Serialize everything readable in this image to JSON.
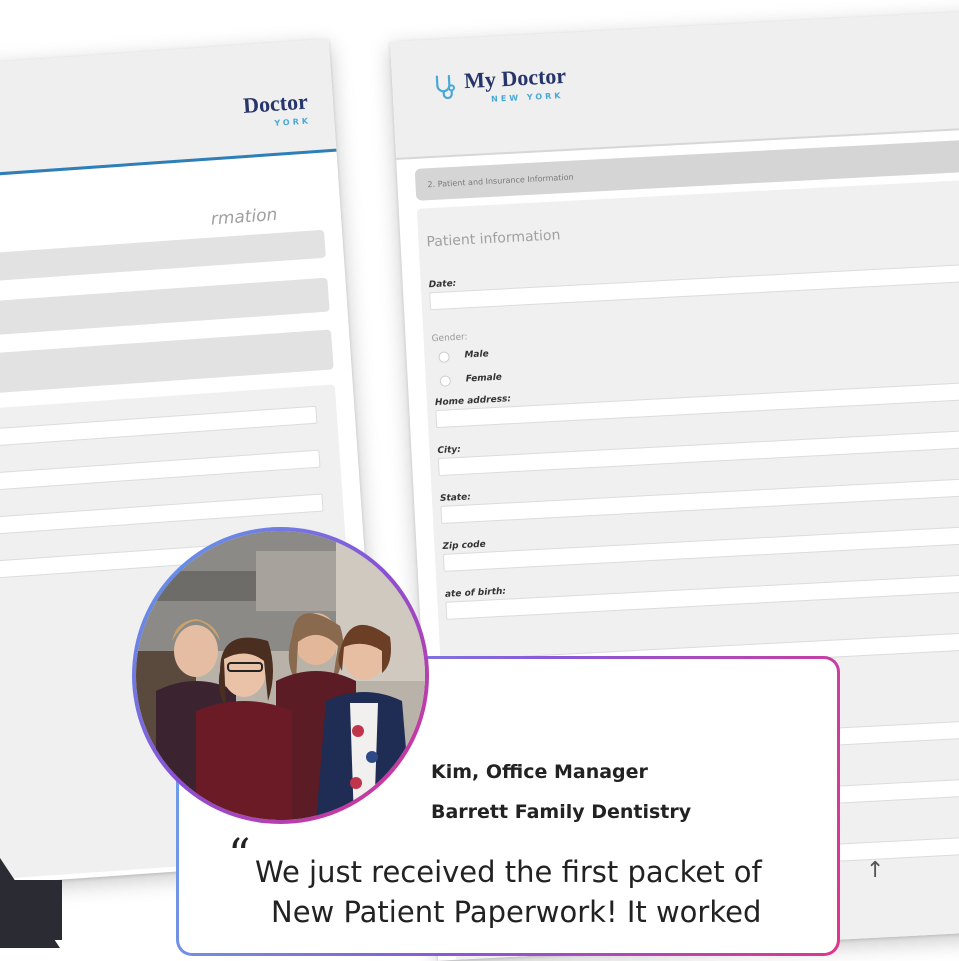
{
  "logo": {
    "title": "My Doctor",
    "subtitle": "NEW YORK",
    "title_partial": "Doctor",
    "subtitle_partial": "YORK"
  },
  "left_form": {
    "heading_partial": "rmation"
  },
  "right_form": {
    "section_title": "2. Patient and Insurance Information",
    "heading": "Patient information",
    "fields": {
      "date": "Date:",
      "gender": "Gender:",
      "male": "Male",
      "female": "Female",
      "home_address": "Home address:",
      "city": "City:",
      "state": "State:",
      "zip": "Zip code",
      "dob_partial": "ate of birth:"
    }
  },
  "testimonial": {
    "person_name": "Kim, Office Manager",
    "organization": "Barrett Family Dentistry",
    "quote_mark": "“",
    "quote_line_1": "We just received the first packet of",
    "quote_line_2": "New Patient Paperwork! It worked"
  },
  "icons": {
    "scroll_top": "arrow-up-icon",
    "logo": "stethoscope-icon"
  },
  "colors": {
    "accent_blue": "#2e7fb8",
    "logo_navy": "#27356b",
    "gradient_start": "#5aa6ee",
    "gradient_end": "#e0308a"
  }
}
